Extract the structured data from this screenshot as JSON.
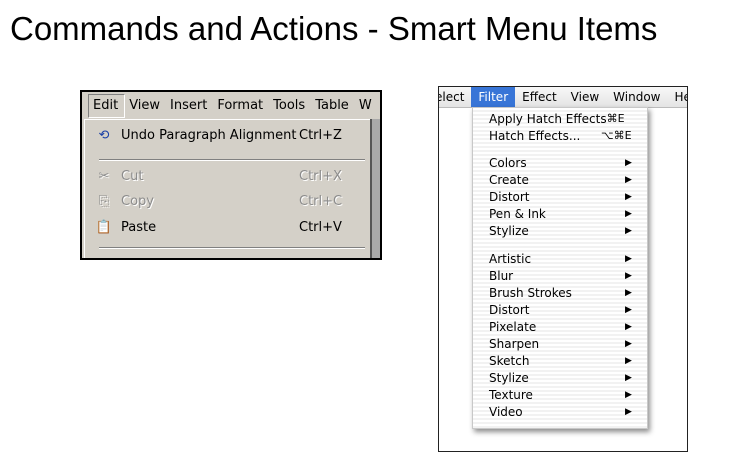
{
  "title": "Commands and Actions - Smart Menu Items",
  "windows_menu": {
    "menubar": [
      {
        "label": "Edit",
        "active": true
      },
      {
        "label": "View"
      },
      {
        "label": "Insert"
      },
      {
        "label": "Format"
      },
      {
        "label": "Tools"
      },
      {
        "label": "Table"
      },
      {
        "label": "W"
      }
    ],
    "items": [
      {
        "icon": "undo-icon",
        "label": "Undo Paragraph Alignment",
        "shortcut": "Ctrl+Z",
        "enabled": true
      },
      {
        "icon": "cut-icon",
        "label": "Cut",
        "shortcut": "Ctrl+X",
        "enabled": false
      },
      {
        "icon": "copy-icon",
        "label": "Copy",
        "shortcut": "Ctrl+C",
        "enabled": false
      },
      {
        "icon": "paste-icon",
        "label": "Paste",
        "shortcut": "Ctrl+V",
        "enabled": true
      }
    ],
    "colors": {
      "menu_bg": "#d4d0c8",
      "disabled_text": "#8c8c8c"
    }
  },
  "mac_menu": {
    "menubar": [
      {
        "label": "elect"
      },
      {
        "label": "Filter",
        "active": true
      },
      {
        "label": "Effect"
      },
      {
        "label": "View"
      },
      {
        "label": "Window"
      },
      {
        "label": "He"
      }
    ],
    "group1": [
      {
        "label": "Apply Hatch Effects",
        "shortcut": "⌘E"
      },
      {
        "label": "Hatch Effects...",
        "shortcut": "⌥⌘E"
      }
    ],
    "group2": [
      "Colors",
      "Create",
      "Distort",
      "Pen & Ink",
      "Stylize"
    ],
    "group3": [
      "Artistic",
      "Blur",
      "Brush Strokes",
      "Distort",
      "Pixelate",
      "Sharpen",
      "Sketch",
      "Stylize",
      "Texture",
      "Video"
    ],
    "submenu_arrow": "▶",
    "colors": {
      "highlight": "#3875d7"
    }
  }
}
